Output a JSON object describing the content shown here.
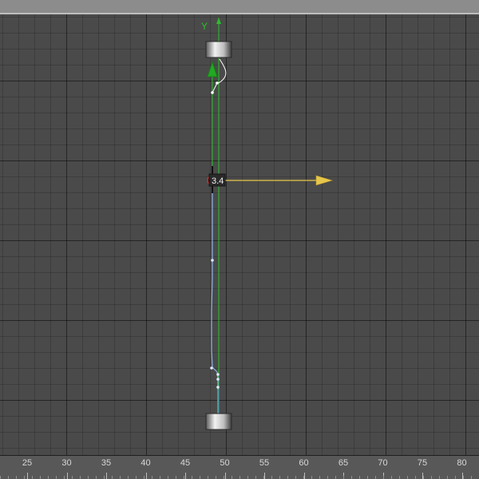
{
  "viewport": {
    "gizmo_value": "3.4",
    "axis_label": "Y",
    "colors": {
      "background": "#4a4a4a",
      "y_axis": "#2ebd2e",
      "x_axis": "#e6c64a",
      "curve": "#8fb3e6",
      "curve_highlight": "#ffffff"
    }
  },
  "ruler": {
    "labels": [
      "25",
      "30",
      "35",
      "40",
      "45",
      "50",
      "55",
      "60",
      "65",
      "70",
      "75",
      "80"
    ]
  },
  "icons": [
    "y-axis-arrow-icon",
    "x-axis-arrow-icon",
    "pivot-handle-icon",
    "top-cap-icon",
    "bottom-cap-icon"
  ]
}
